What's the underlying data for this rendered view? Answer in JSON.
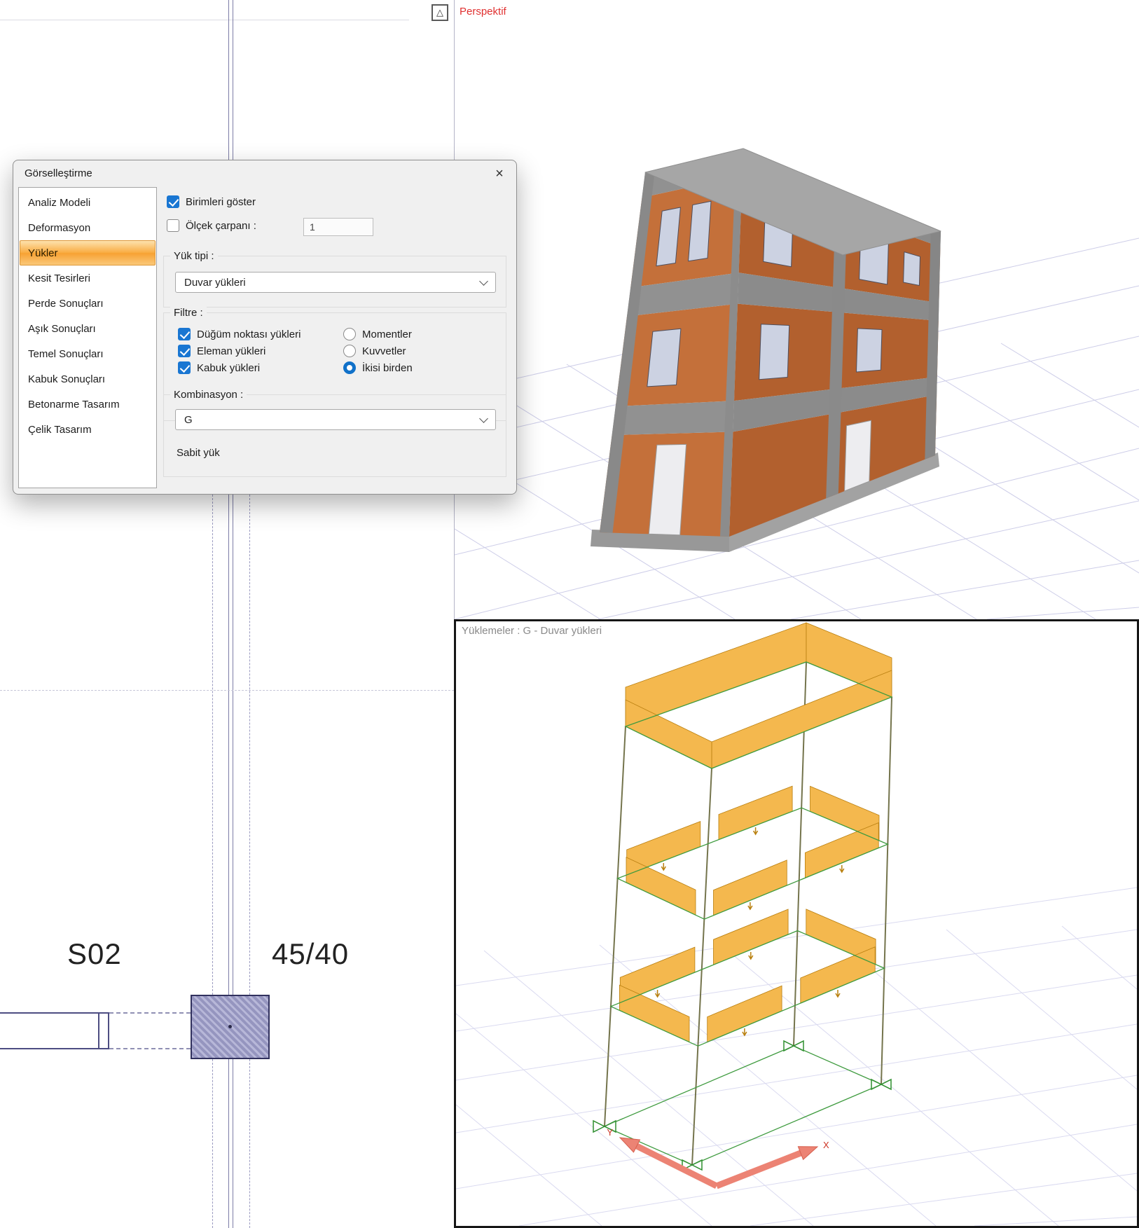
{
  "colors": {
    "accent_orange": "#f7a233",
    "selection_border": "#dd9737",
    "checkbox_blue": "#1976d2",
    "perspective_label_red": "#e03030",
    "brick": "#c4703a",
    "brick_dark": "#b2602e",
    "concrete_gray": "#8c8c8c",
    "load_band_orange": "#f4b84e",
    "load_band_border": "#b97f10",
    "wireframe_green": "#3f9b3f",
    "support_green": "#2f8f2f",
    "axis_red": "#ec8374"
  },
  "top_bar": {
    "perspective_label": "Perspektif",
    "maximize_icon_glyph": "△"
  },
  "plan_view": {
    "column_label": "S02",
    "beam_label": "45/40"
  },
  "loads_view": {
    "title": "Yüklemeler : G - Duvar yükleri",
    "axis_x_label": "X",
    "axis_y_label": "Y"
  },
  "dialog": {
    "title": "Görselleştirme",
    "close_label": "×",
    "nav_items": [
      {
        "label": "Analiz Modeli",
        "selected": false
      },
      {
        "label": "Deformasyon",
        "selected": false
      },
      {
        "label": "Yükler",
        "selected": true
      },
      {
        "label": "Kesit Tesirleri",
        "selected": false
      },
      {
        "label": "Perde Sonuçları",
        "selected": false
      },
      {
        "label": "Aşık Sonuçları",
        "selected": false
      },
      {
        "label": "Temel Sonuçları",
        "selected": false
      },
      {
        "label": "Kabuk Sonuçları",
        "selected": false
      },
      {
        "label": "Betonarme Tasarım",
        "selected": false
      },
      {
        "label": "Çelik Tasarım",
        "selected": false
      }
    ],
    "show_units_checkbox": {
      "label": "Birimleri göster",
      "checked": true
    },
    "scale_factor": {
      "label": "Ölçek çarpanı :",
      "checked": false,
      "value": "1"
    },
    "load_type_group": {
      "label": "Yük tipi :",
      "selected_option": "Duvar yükleri"
    },
    "filter_group": {
      "label": "Filtre :",
      "checkboxes": [
        {
          "label": "Düğüm noktası yükleri",
          "checked": true
        },
        {
          "label": "Eleman yükleri",
          "checked": true
        },
        {
          "label": "Kabuk yükleri",
          "checked": true
        }
      ],
      "radios": [
        {
          "label": "Momentler",
          "selected": false
        },
        {
          "label": "Kuvvetler",
          "selected": false
        },
        {
          "label": "İkisi birden",
          "selected": true
        }
      ]
    },
    "combination_group": {
      "label": "Kombinasyon :",
      "selected_option": "G",
      "description": "Sabit yük"
    }
  }
}
